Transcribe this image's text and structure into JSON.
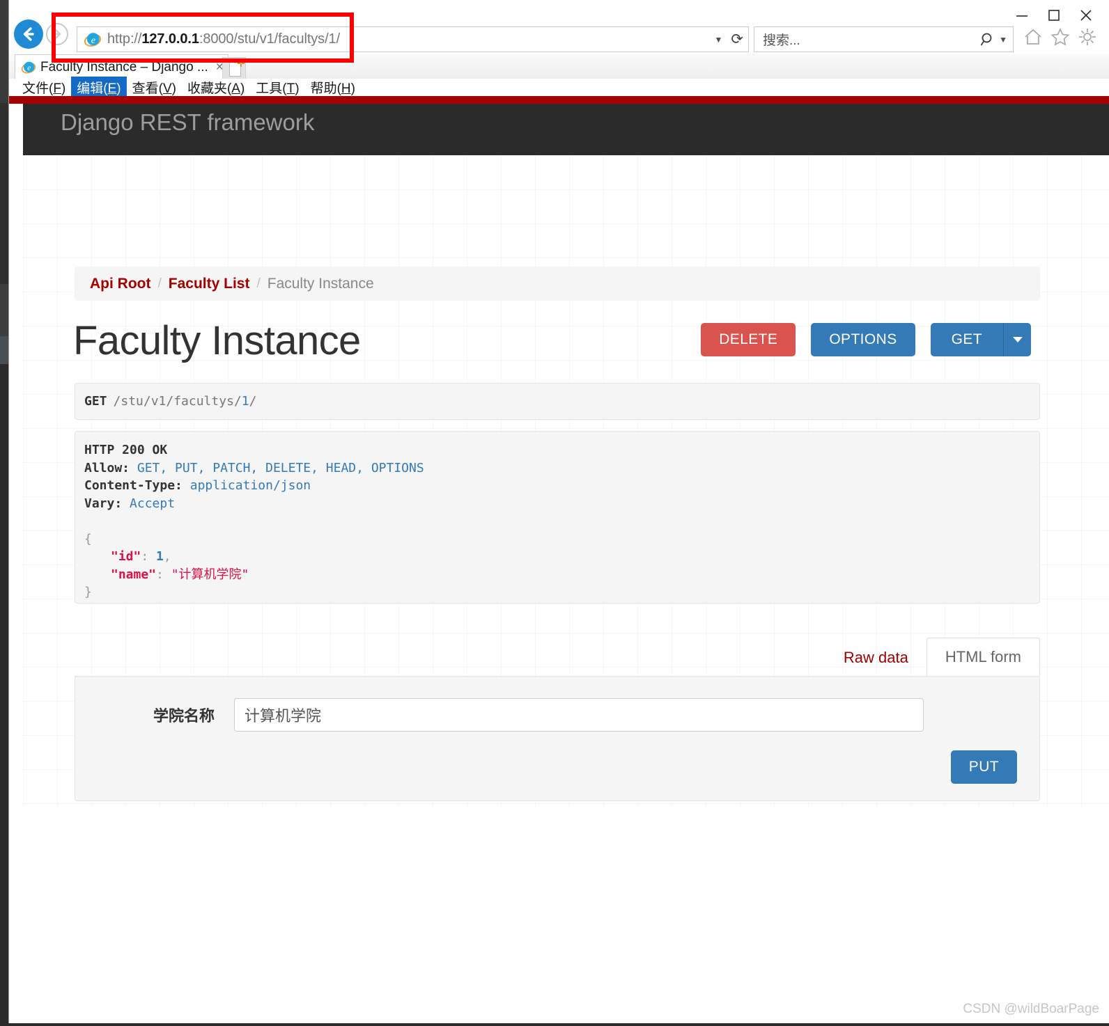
{
  "browser": {
    "window_controls": {
      "minimize": "minimize-icon",
      "maximize": "maximize-icon",
      "close": "close-icon"
    },
    "back_icon": "back-arrow-icon",
    "forward_icon": "forward-arrow-icon",
    "address": {
      "scheme": "http://",
      "host": "127.0.0.1",
      "rest": ":8000/stu/v1/facultys/1/",
      "full": "http://127.0.0.1:8000/stu/v1/facultys/1/"
    },
    "search": {
      "placeholder": "搜索...",
      "icon": "search-icon"
    },
    "toolbar_icons": [
      "home-icon",
      "star-icon",
      "gear-icon"
    ],
    "tab": {
      "title": "Faculty Instance – Django ...",
      "close": "×",
      "new_tab": "new-tab-icon"
    },
    "menu": [
      {
        "pre": "文件(",
        "key": "F",
        "post": ")",
        "selected": false
      },
      {
        "pre": "编辑(",
        "key": "E",
        "post": ")",
        "selected": true
      },
      {
        "pre": "查看(",
        "key": "V",
        "post": ")",
        "selected": false
      },
      {
        "pre": "收藏夹(",
        "key": "A",
        "post": ")",
        "selected": false
      },
      {
        "pre": "工具(",
        "key": "T",
        "post": ")",
        "selected": false
      },
      {
        "pre": "帮助(",
        "key": "H",
        "post": ")",
        "selected": false
      }
    ]
  },
  "page": {
    "brand": "Django REST framework",
    "breadcrumb": {
      "items": [
        "Api Root",
        "Faculty List"
      ],
      "current": "Faculty Instance",
      "separator": "/"
    },
    "title": "Faculty Instance",
    "actions": {
      "delete": "DELETE",
      "options": "OPTIONS",
      "get": "GET",
      "caret": "chevron-down-icon"
    },
    "request": {
      "method": "GET",
      "path_prefix": "/stu/v1/facultys/",
      "path_id": "1",
      "path_suffix": "/"
    },
    "response": {
      "status": "HTTP 200 OK",
      "headers": [
        {
          "name": "Allow:",
          "value": "GET, PUT, PATCH, DELETE, HEAD, OPTIONS"
        },
        {
          "name": "Content-Type:",
          "value": "application/json"
        },
        {
          "name": "Vary:",
          "value": "Accept"
        }
      ],
      "body": {
        "open": "{",
        "close": "}",
        "lines": [
          {
            "key": "\"id\"",
            "colon": ": ",
            "value": "1",
            "type": "num",
            "comma": ","
          },
          {
            "key": "\"name\"",
            "colon": ": ",
            "value": "\"计算机学院\"",
            "type": "str",
            "comma": ""
          }
        ]
      }
    },
    "tabs": {
      "raw": "Raw data",
      "html": "HTML form"
    },
    "form": {
      "label": "学院名称",
      "value": "计算机学院",
      "submit": "PUT"
    }
  },
  "watermark": "CSDN @wildBoarPage",
  "colors": {
    "brand_red": "#a50000",
    "navbar": "#2b2b2b",
    "primary": "#337ab7",
    "danger": "#d9534f",
    "link": "#a30000",
    "annotation": "#ff0000"
  }
}
